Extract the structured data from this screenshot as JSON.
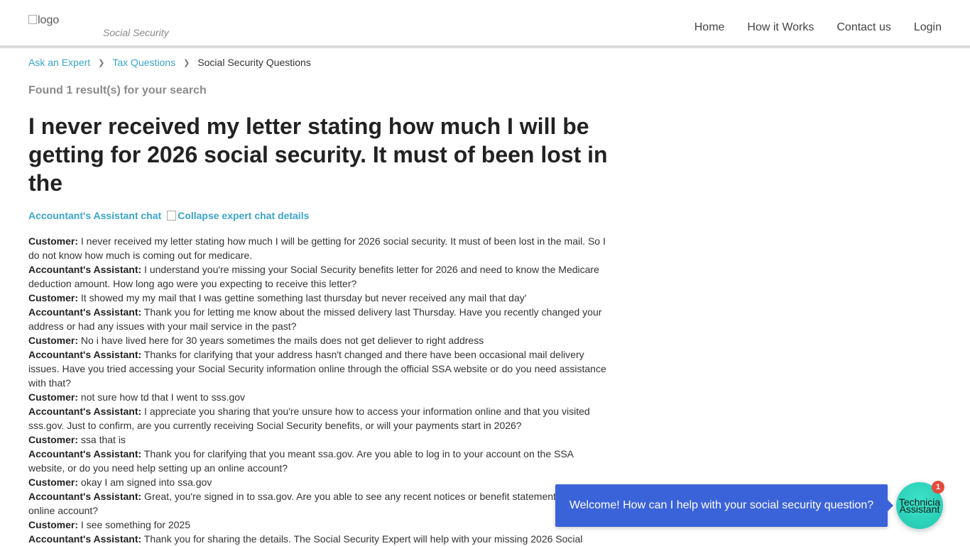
{
  "header": {
    "logo_alt": "logo",
    "tagline": "Social Security",
    "nav": [
      "Home",
      "How it Works",
      "Contact us",
      "Login"
    ]
  },
  "breadcrumb": {
    "items": [
      "Ask an Expert",
      "Tax Questions"
    ],
    "current": "Social Security Questions"
  },
  "search": {
    "found_text": "Found 1 result(s) for your search"
  },
  "question": {
    "title": "I never received my letter stating how much I will be getting for 2026 social security. It must of been lost in the"
  },
  "chat": {
    "heading": "Accountant's Assistant chat",
    "collapse_alt": "Collapse expert chat details",
    "messages": [
      {
        "speaker": "Customer:",
        "text": " I never received my letter stating how much I will be getting for 2026 social security. It must of been lost in the mail. So I do not know how much is coming out for medicare."
      },
      {
        "speaker": "Accountant's Assistant:",
        "text": " I understand you're missing your Social Security benefits letter for 2026 and need to know the Medicare deduction amount. How long ago were you expecting to receive this letter?"
      },
      {
        "speaker": "Customer:",
        "text": " It showed my my mail that I was gettine something last thursday but never received any mail that day'"
      },
      {
        "speaker": "Accountant's Assistant:",
        "text": " Thank you for letting me know about the missed delivery last Thursday. Have you recently changed your address or had any issues with your mail service in the past?"
      },
      {
        "speaker": "Customer:",
        "text": " No i have lived here for 30 years sometimes the mails does not get deliever to right address"
      },
      {
        "speaker": "Accountant's Assistant:",
        "text": " Thanks for clarifying that your address hasn't changed and there have been occasional mail delivery issues. Have you tried accessing your Social Security information online through the official SSA website or do you need assistance with that?"
      },
      {
        "speaker": "Customer:",
        "text": " not sure how td that I went to sss.gov"
      },
      {
        "speaker": "Accountant's Assistant:",
        "text": " I appreciate you sharing that you're unsure how to access your information online and that you visited sss.gov. Just to confirm, are you currently receiving Social Security benefits, or will your payments start in 2026?"
      },
      {
        "speaker": "Customer:",
        "text": " ssa that is"
      },
      {
        "speaker": "Accountant's Assistant:",
        "text": " Thank you for clarifying that you meant ssa.gov. Are you able to log in to your account on the SSA website, or do you need help setting up an online account?"
      },
      {
        "speaker": "Customer:",
        "text": " okay I am signed into ssa.gov"
      },
      {
        "speaker": "Accountant's Assistant:",
        "text": " Great, you're signed in to ssa.gov. Are you able to see any recent notices or benefit statements in your online account?"
      },
      {
        "speaker": "Customer:",
        "text": " I see something for 2025"
      },
      {
        "speaker": "Accountant's Assistant:",
        "text": " Thank you for sharing the details. The Social Security Expert will help with your missing 2026 Social"
      }
    ]
  },
  "widget": {
    "welcome": "Welcome! How can I help with your social security question?",
    "bot_label_line1": "Technicia",
    "bot_label_line2": "Assistant",
    "badge_count": "1",
    "colors": {
      "bubble": "#3b63d9",
      "bot": "#2fd8c0",
      "badge": "#e54b3c"
    }
  },
  "colors": {
    "link": "#3aa5c9",
    "title": "#222222"
  }
}
